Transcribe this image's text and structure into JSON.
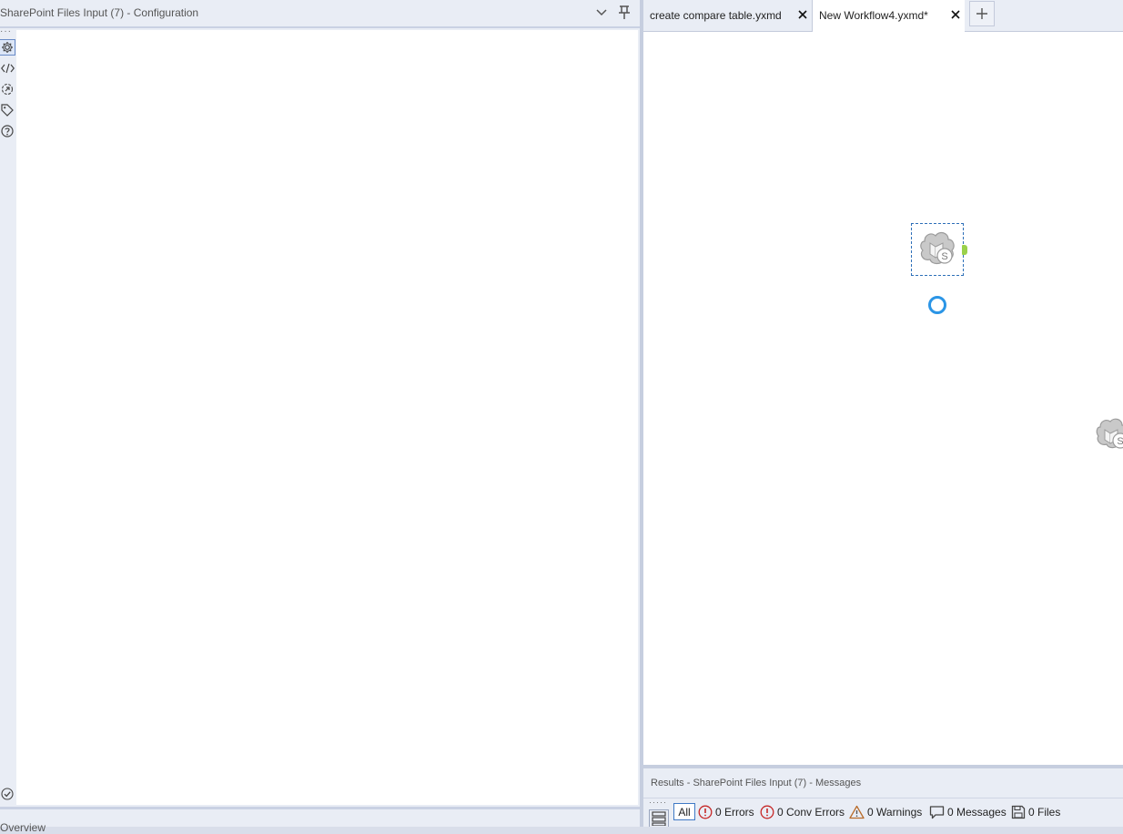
{
  "config_pane": {
    "title": "SharePoint Files Input (7) - Configuration",
    "toolbar_icons": [
      "configuration-gear-icon",
      "xml-code-icon",
      "annotation-icon",
      "tag-icon",
      "help-icon",
      "check-icon"
    ]
  },
  "bottom_pane": {
    "title": "Overview"
  },
  "tabs": [
    {
      "label": "create compare table.yxmd",
      "active": false
    },
    {
      "label": "New Workflow4.yxmd*",
      "active": true
    }
  ],
  "canvas": {
    "tool_node": {
      "icon": "sharepoint-files-input-icon",
      "letter": "S"
    },
    "ghost_node": {
      "icon": "sharepoint-files-input-icon",
      "letter": "S"
    }
  },
  "results": {
    "title": "Results - SharePoint Files Input (7) - Messages",
    "all_label": "All",
    "filters": {
      "errors": "0 Errors",
      "conv_errors": "0 Conv Errors",
      "warnings": "0 Warnings",
      "messages": "0 Messages",
      "files": "0 Files"
    }
  },
  "colors": {
    "accent": "#2d6fb8",
    "spinner": "#2b95e6",
    "anchor": "#9ad14b",
    "error": "#c62828",
    "warning": "#b86b2a"
  }
}
